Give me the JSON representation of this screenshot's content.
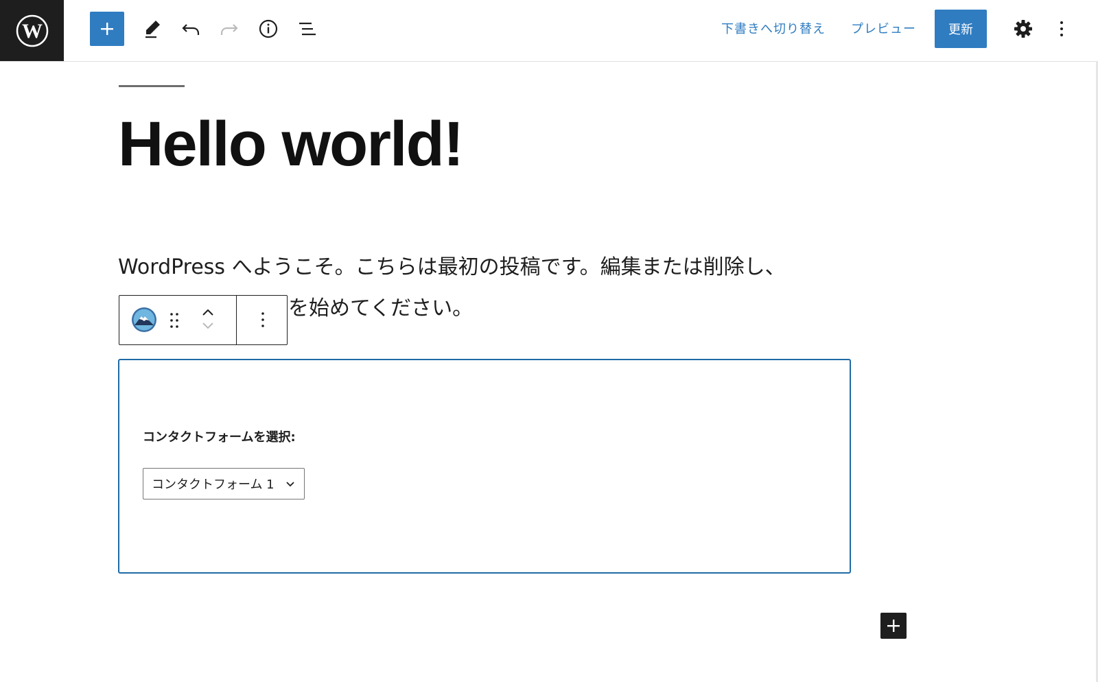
{
  "toolbar": {
    "switch_to_draft": "下書きへ切り替え",
    "preview": "プレビュー",
    "update": "更新"
  },
  "icons": {
    "logo": "wordpress-logo-icon",
    "add": "plus-icon",
    "tools": "pencil-icon",
    "undo": "undo-icon",
    "redo": "redo-icon",
    "details": "info-icon",
    "outline": "list-view-icon",
    "settings": "gear-icon",
    "options": "vertical-ellipsis-icon"
  },
  "colors": {
    "accent": "#2f7cc1",
    "dark": "#1e1e1e",
    "block_border": "#1e6aa6"
  },
  "post": {
    "title": "Hello world!",
    "paragraph_line1": "WordPress へようこそ。こちらは最初の投稿です。編集または削除し、",
    "paragraph_line2": "を始めてください。"
  },
  "cf7_block": {
    "label": "コンタクトフォームを選択:",
    "selected": "コンタクトフォーム 1"
  }
}
